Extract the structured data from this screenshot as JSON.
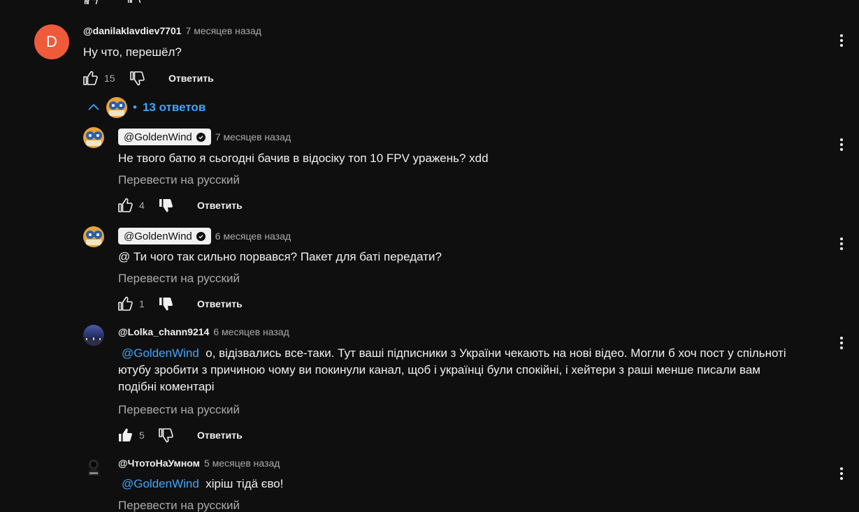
{
  "top_comment": {
    "avatar_letter": "D",
    "author": "@danilaklavdiev7701",
    "time": "7 месяцев назад",
    "text": "Ну что, перешёл?",
    "likes": "15",
    "reply_label": "Ответить"
  },
  "replies_toggle": {
    "dot": "•",
    "label": "13 ответов"
  },
  "replies": [
    {
      "author": "@GoldenWind",
      "time": "7 месяцев назад",
      "text": "Не твого батю я сьогодні бачив в відосіку топ 10 FPV уражень? xdd",
      "translate": "Перевести на русский",
      "likes": "4",
      "reply_label": "Ответить"
    },
    {
      "author": "@GoldenWind",
      "time": "6 месяцев назад",
      "text": "@ Ти чого так сильно порвався? Пакет для баті передати?",
      "translate": "Перевести на русский",
      "likes": "1",
      "reply_label": "Ответить"
    },
    {
      "author": "@Lolka_chann9214",
      "time": "6 месяцев назад",
      "mention": "@GoldenWind",
      "text_line1": "о, відізвались все-таки. Тут ваші підписники з України чекають на нові відео. Могли б хоч пост у спільноті",
      "text_line2": "ютубу зробити з причиною чому ви покинули канал, щоб і українці були спокійні, і хейтери з раші менше писали вам",
      "text_line3": "подібні коментарі",
      "translate": "Перевести на русский",
      "likes": "5",
      "reply_label": "Ответить"
    },
    {
      "author": "@ЧтотоНаУмном",
      "time": "5 месяцев назад",
      "mention": "@GoldenWind",
      "text": "хіріш тідä єво!",
      "translate": "Перевести на русский"
    }
  ]
}
